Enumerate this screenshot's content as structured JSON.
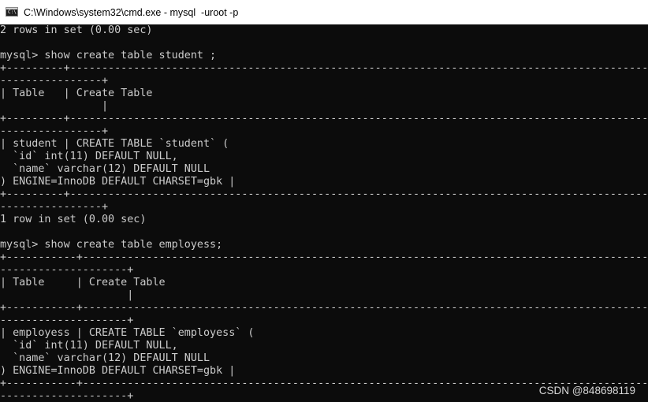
{
  "window": {
    "title": "C:\\Windows\\system32\\cmd.exe - mysql  -uroot -p",
    "icon": "cmd-icon"
  },
  "console": {
    "lines": [
      "2 rows in set (0.00 sec)",
      "",
      "mysql> show create table student ;",
      "+---------+--------------------------------------------------------------------------------------------------------",
      "----------------+",
      "| Table   | Create Table",
      "                |",
      "+---------+--------------------------------------------------------------------------------------------------------",
      "----------------+",
      "| student | CREATE TABLE `student` (",
      "  `id` int(11) DEFAULT NULL,",
      "  `name` varchar(12) DEFAULT NULL",
      ") ENGINE=InnoDB DEFAULT CHARSET=gbk |",
      "+---------+--------------------------------------------------------------------------------------------------------",
      "----------------+",
      "1 row in set (0.00 sec)",
      "",
      "mysql> show create table employess;",
      "+-----------+------------------------------------------------------------------------------------------------------",
      "--------------------+",
      "| Table     | Create Table",
      "                    |",
      "+-----------+------------------------------------------------------------------------------------------------------",
      "--------------------+",
      "| employess | CREATE TABLE `employess` (",
      "  `id` int(11) DEFAULT NULL,",
      "  `name` varchar(12) DEFAULT NULL",
      ") ENGINE=InnoDB DEFAULT CHARSET=gbk |",
      "+-----------+------------------------------------------------------------------------------------------------------",
      "--------------------+"
    ]
  },
  "watermark": "CSDN @848698119"
}
